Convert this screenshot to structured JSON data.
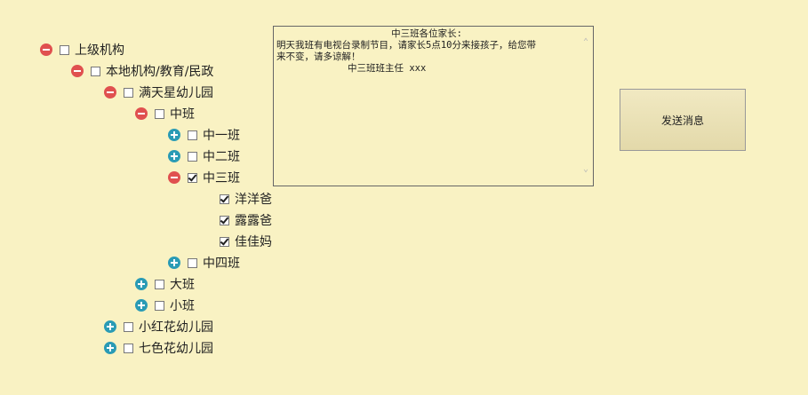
{
  "tree": {
    "root": {
      "label": "上级机构",
      "state": "expanded",
      "checked": false
    },
    "local": {
      "label": "本地机构/教育/民政",
      "state": "expanded",
      "checked": false
    },
    "mantianxing": {
      "label": "满天星幼儿园",
      "state": "expanded",
      "checked": false
    },
    "zhongban": {
      "label": "中班",
      "state": "expanded",
      "checked": false
    },
    "zhong1": {
      "label": "中一班",
      "state": "collapsed",
      "checked": false
    },
    "zhong2": {
      "label": "中二班",
      "state": "collapsed",
      "checked": false
    },
    "zhong3": {
      "label": "中三班",
      "state": "expanded",
      "checked": true
    },
    "parent1": {
      "label": "洋洋爸",
      "checked": true
    },
    "parent2": {
      "label": "露露爸",
      "checked": true
    },
    "parent3": {
      "label": "佳佳妈",
      "checked": true
    },
    "zhong4": {
      "label": "中四班",
      "state": "collapsed",
      "checked": false
    },
    "daban": {
      "label": "大班",
      "state": "collapsed",
      "checked": false
    },
    "xiaoban": {
      "label": "小班",
      "state": "collapsed",
      "checked": false
    },
    "xiaohonghua": {
      "label": "小红花幼儿园",
      "state": "collapsed",
      "checked": false
    },
    "qisehua": {
      "label": "七色花幼儿园",
      "state": "collapsed",
      "checked": false
    }
  },
  "message": {
    "greeting": "中三班各位家长:",
    "body_line1": "明天我班有电视台录制节目，请家长5点10分来接孩子，给您带",
    "body_line2": "来不变，请多谅解！",
    "signature": "中三班班主任 xxx"
  },
  "send_button": {
    "label": "发送消息"
  },
  "colors": {
    "background": "#f9f2c3",
    "collapse_icon": "#e0504f",
    "expand_icon": "#2a9bb5"
  }
}
